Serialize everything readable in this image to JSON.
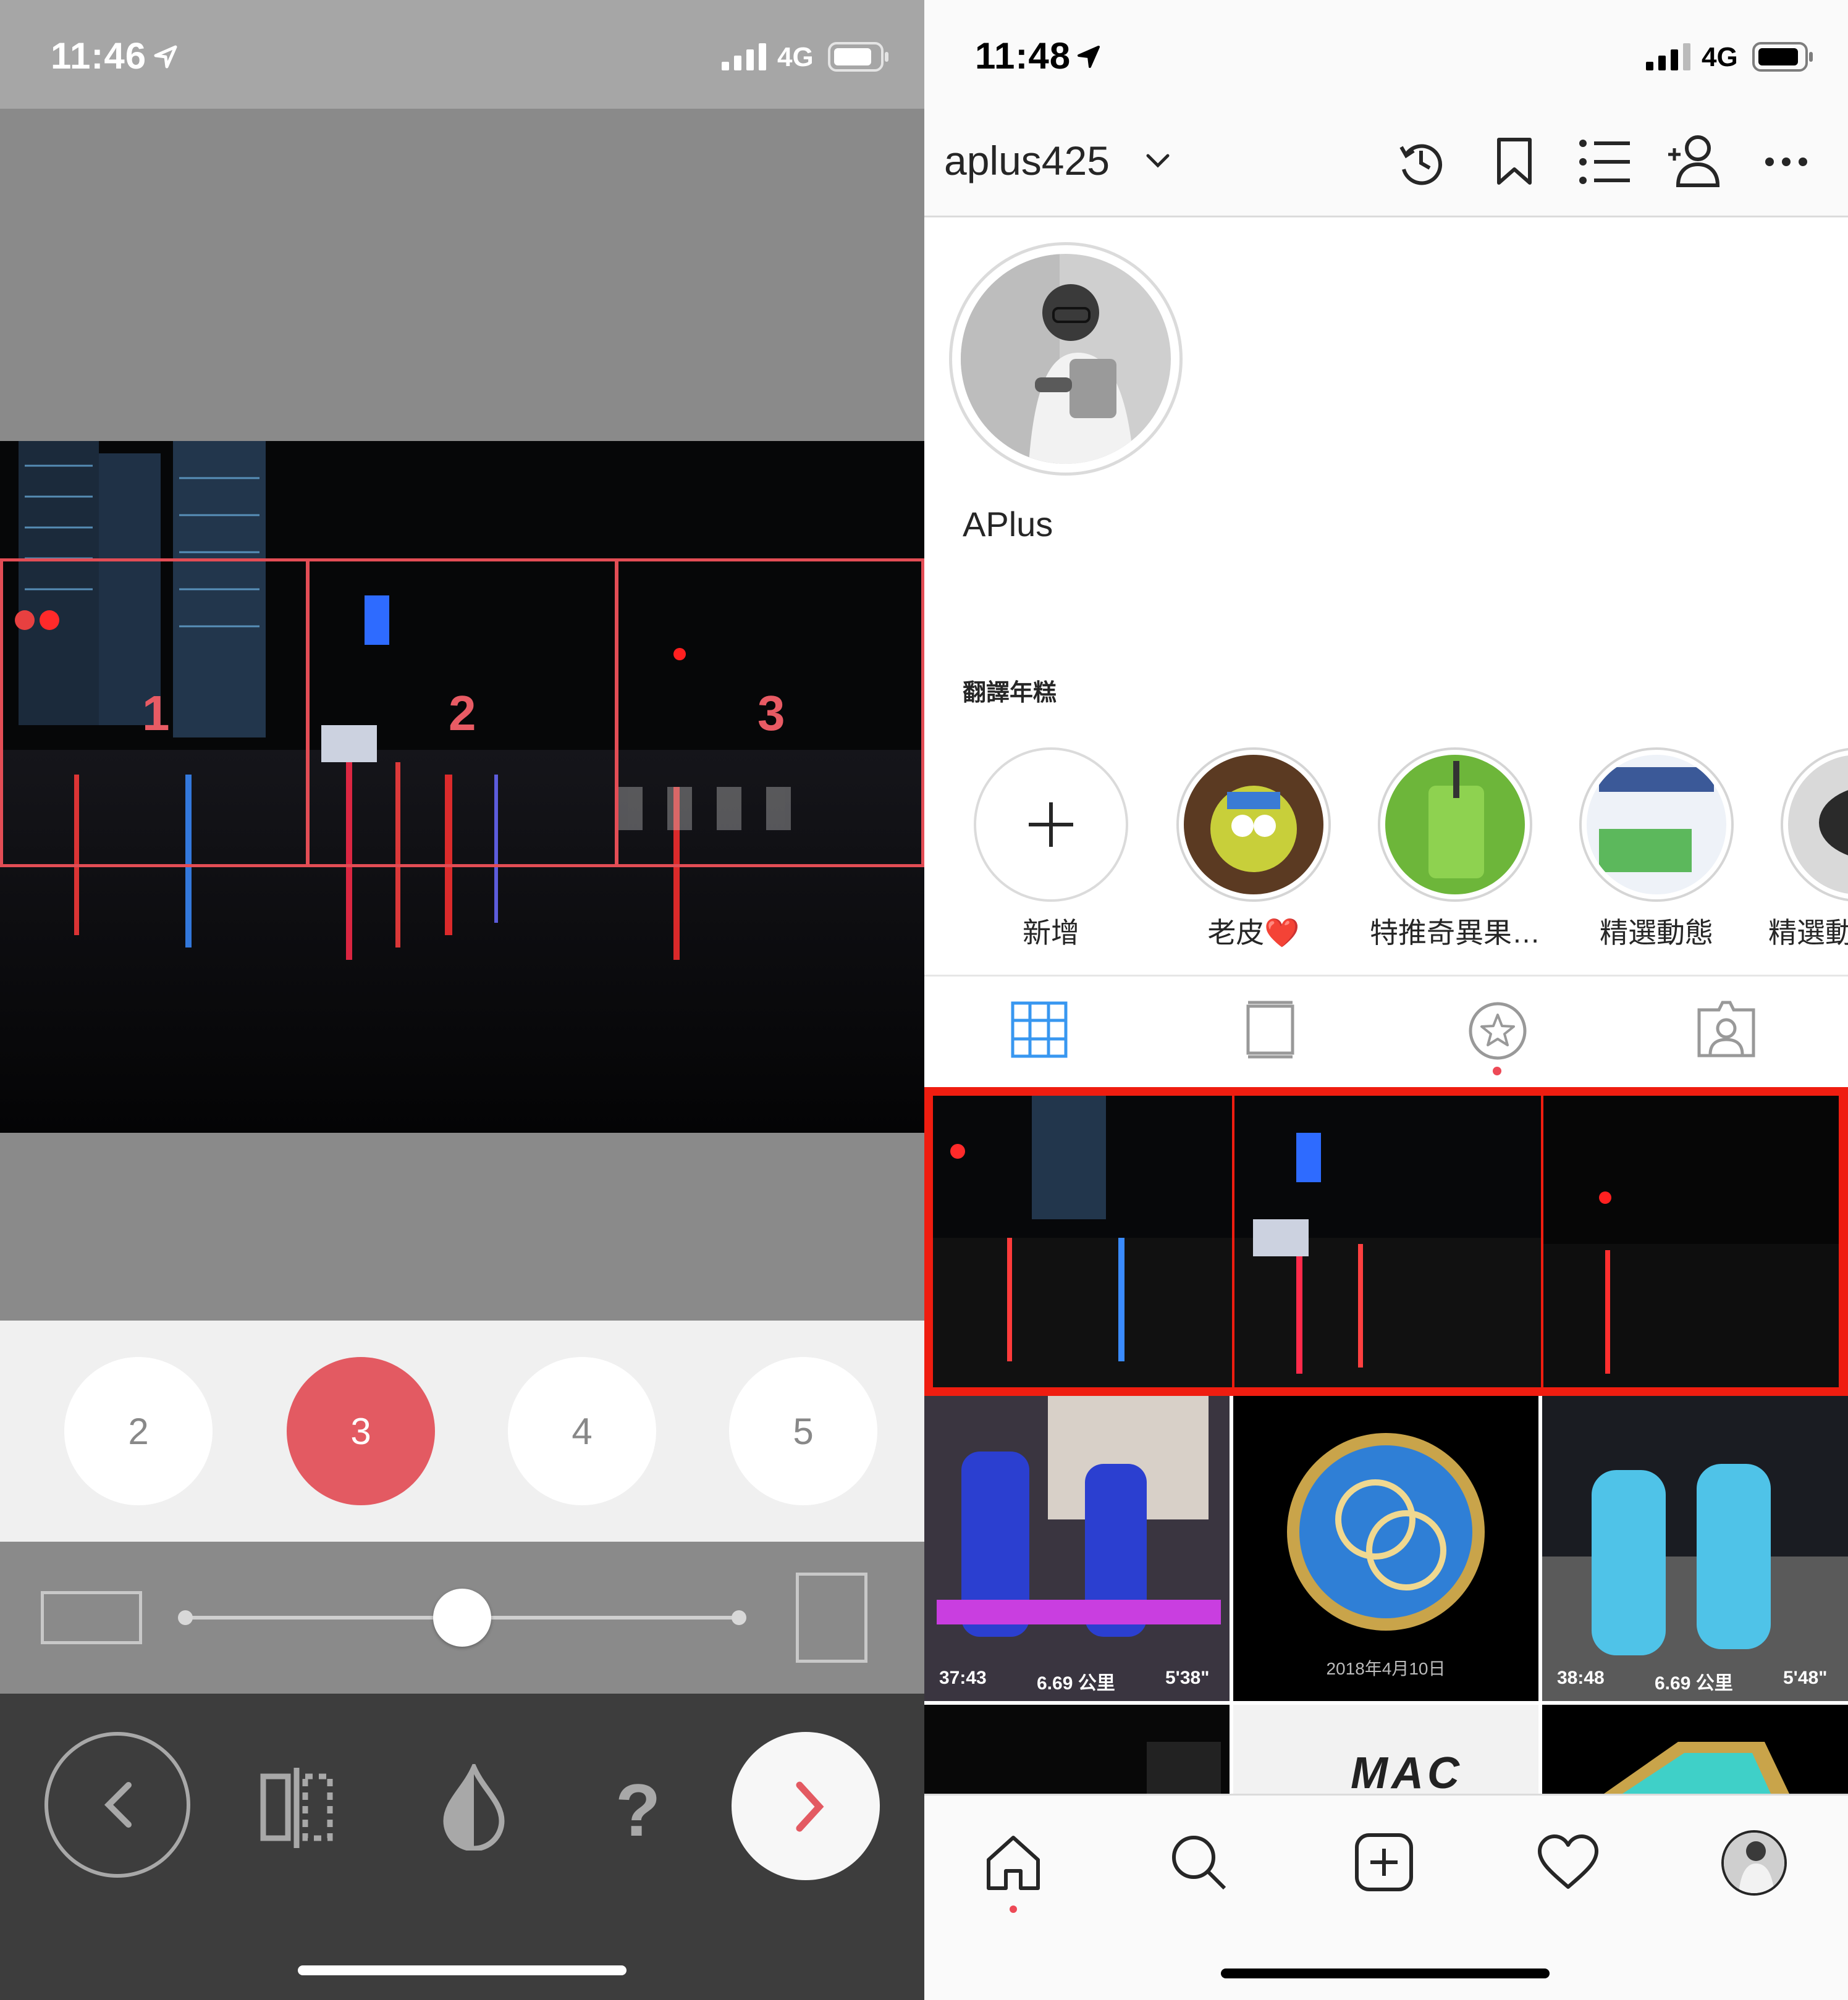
{
  "left_app": {
    "status": {
      "time": "11:46",
      "network": "4G"
    },
    "grid_numbers": [
      "1",
      "2",
      "3"
    ],
    "count_options": [
      {
        "label": "2",
        "selected": false
      },
      {
        "label": "3",
        "selected": true
      },
      {
        "label": "4",
        "selected": false
      },
      {
        "label": "5",
        "selected": false
      }
    ],
    "aspect_slider_level": 0.5,
    "toolbar": {
      "back_icon": "chevron-left-icon",
      "flip_icon": "mirror-split-icon",
      "contrast_icon": "drop-half-icon",
      "help_label": "?",
      "next_icon": "chevron-right-icon"
    },
    "colors": {
      "accent": "#e35a62",
      "frame": "#e34d55"
    }
  },
  "right_app": {
    "status": {
      "time": "11:48",
      "network": "4G"
    },
    "header": {
      "username": "aplus425",
      "chevron": "⌄"
    },
    "profile": {
      "display_name": "APlus",
      "bio": "翻譯年糕"
    },
    "highlights": [
      {
        "label": "新增",
        "kind": "add"
      },
      {
        "label": "老皮❤️",
        "kind": "photo"
      },
      {
        "label": "特推奇異果…",
        "kind": "photo"
      },
      {
        "label": "精選動態",
        "kind": "photo"
      },
      {
        "label": "精選動",
        "kind": "photo"
      }
    ],
    "tabs": [
      "grid-icon",
      "feed-icon",
      "igtv-star-icon",
      "tagged-icon"
    ],
    "posts_row2": [
      {
        "kind": "run",
        "duration": "37:43",
        "distance": "6.69 公里",
        "pace": "5'38\""
      },
      {
        "kind": "badge",
        "caption": "2018年4月10日"
      },
      {
        "kind": "run",
        "duration": "38:48",
        "distance": "6.69 公里",
        "pace": "5'48\""
      }
    ],
    "posts_row3_text": "MAC",
    "nav": [
      "home-icon",
      "search-icon",
      "add-post-icon",
      "heart-icon",
      "profile-avatar"
    ],
    "colors": {
      "highlight_frame": "#ef1d10",
      "tab_active": "#3897f0"
    }
  }
}
